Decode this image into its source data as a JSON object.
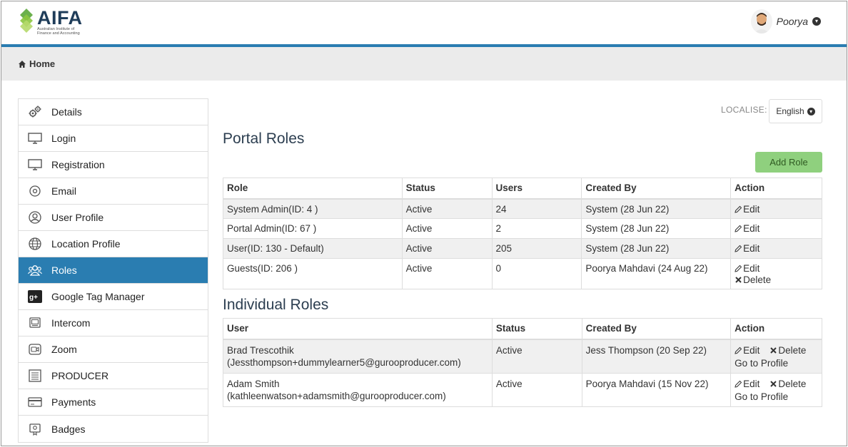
{
  "header": {
    "brand": "AIFA",
    "brand_subtitle": "Australian Institute of Finance and Accounting",
    "user_name": "Poorya"
  },
  "breadcrumb": {
    "home_label": "Home"
  },
  "sidebar": {
    "items": [
      {
        "label": "Details",
        "icon": "gears-icon"
      },
      {
        "label": "Login",
        "icon": "monitor-icon"
      },
      {
        "label": "Registration",
        "icon": "monitor-icon"
      },
      {
        "label": "Email",
        "icon": "at-icon"
      },
      {
        "label": "User Profile",
        "icon": "user-circle-icon"
      },
      {
        "label": "Location Profile",
        "icon": "globe-icon"
      },
      {
        "label": "Roles",
        "icon": "users-icon",
        "active": true
      },
      {
        "label": "Google Tag Manager",
        "icon": "google-plus-icon"
      },
      {
        "label": "Intercom",
        "icon": "intercom-icon"
      },
      {
        "label": "Zoom",
        "icon": "video-icon"
      },
      {
        "label": "PRODUCER",
        "icon": "list-icon"
      },
      {
        "label": "Payments",
        "icon": "credit-card-icon"
      },
      {
        "label": "Badges",
        "icon": "badge-icon"
      }
    ]
  },
  "localise": {
    "label": "LOCALISE:",
    "language": "English"
  },
  "portal_roles": {
    "title": "Portal Roles",
    "add_label": "Add Role",
    "columns": [
      "Role",
      "Status",
      "Users",
      "Created By",
      "Action"
    ],
    "rows": [
      {
        "role": "System Admin(ID: 4 )",
        "status": "Active",
        "users": "24",
        "created_by": "System (28 Jun 22)",
        "edit": "Edit"
      },
      {
        "role": "Portal Admin(ID: 67 )",
        "status": "Active",
        "users": "2",
        "created_by": "System (28 Jun 22)",
        "edit": "Edit"
      },
      {
        "role": "User(ID: 130 - Default)",
        "status": "Active",
        "users": "205",
        "created_by": "System (28 Jun 22)",
        "edit": "Edit"
      },
      {
        "role": "Guests(ID: 206 )",
        "status": "Active",
        "users": "0",
        "created_by": "Poorya Mahdavi (24 Aug 22)",
        "edit": "Edit",
        "delete": "Delete"
      }
    ]
  },
  "individual_roles": {
    "title": "Individual Roles",
    "columns": [
      "User",
      "Status",
      "Created By",
      "Action"
    ],
    "rows": [
      {
        "name": "Brad Trescothik",
        "email": "(Jessthompson+dummylearner5@gurooproducer.com)",
        "status": "Active",
        "created_by": "Jess Thompson (20 Sep 22)",
        "edit": "Edit",
        "delete": "Delete",
        "profile": "Go to Profile"
      },
      {
        "name": "Adam Smith",
        "email": "(kathleenwatson+adamsmith@gurooproducer.com)",
        "status": "Active",
        "created_by": "Poorya Mahdavi (15 Nov 22)",
        "edit": "Edit",
        "delete": "Delete",
        "profile": "Go to Profile"
      }
    ]
  },
  "colors": {
    "accent": "#2a7db1",
    "add_button": "#8fd07e",
    "logo_green": "#6ab04c",
    "brand_text": "#1f3d5a"
  }
}
